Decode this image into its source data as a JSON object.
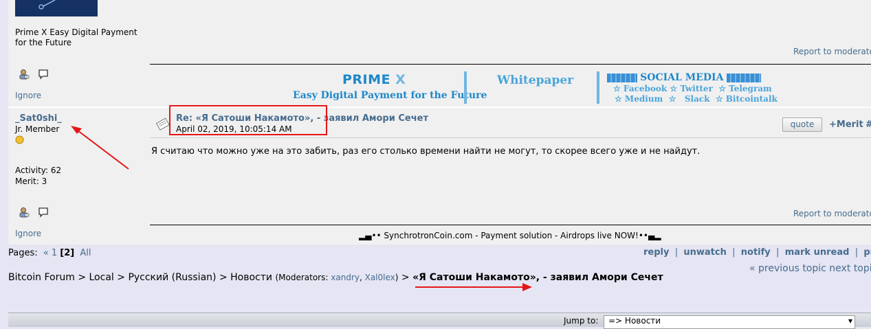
{
  "post1": {
    "signature_text": "Prime X Easy Digital Payment for the Future",
    "ignore_label": "Ignore",
    "report_label": "Report to moderator",
    "banner": {
      "title_part1": "PRIME",
      "title_part2": "X",
      "subtitle": "Easy Digital Payment for the Future",
      "whitepaper": "Whitepaper",
      "social_title": "SOCIAL MEDIA",
      "social_row1": "☆ Facebook ☆ Twitter  ☆ Telegram",
      "social_row2": "☆ Medium  ☆   Slack  ☆ Bitcointalk"
    }
  },
  "post2": {
    "username": "_Sat0shi_",
    "rank": "Jr. Member",
    "activity": "Activity: 62",
    "merit": "Merit: 3",
    "ignore_label": "Ignore",
    "title": "Re: «Я Сатоши Накамото», - заявил Амори Сечет",
    "date": "April 02, 2019, 10:05:14 AM",
    "body": "Я считаю что можно уже на это забить, раз его столько времени найти не могут, то скорее всего уже и не найдут.",
    "quote_label": "quote",
    "merit_label": "+Merit",
    "hash": "#",
    "report_label": "Report to moderator",
    "signature": "▂▄•• SynchrotronCoin.com - Payment solution - Airdrops live NOW!••▄▂"
  },
  "pages": {
    "label": "Pages:",
    "prev": "«",
    "page1": "1",
    "current": "[2]",
    "all": "All"
  },
  "actions": [
    "reply",
    "unwatch",
    "notify",
    "mark unread",
    "print"
  ],
  "topic_nav": "« previous topic next topic »",
  "breadcrumb": {
    "forum": "Bitcoin Forum",
    "local": "Local",
    "russian": "Русский (Russian)",
    "news": "Новости",
    "moderators_label": "(Moderators: ",
    "mod1": "xandry",
    "mod2": "Xal0lex",
    "moderators_end": ")",
    "sep": ">",
    "topic": "«Я Сатоши Накамото», - заявил Амори Сечет"
  },
  "jump": {
    "label": "Jump to:",
    "selected": "=> Новости"
  },
  "colors": {
    "annotation_red": "#e51616",
    "link_blue": "#476c8e",
    "brand_blue": "#1e87c9"
  }
}
